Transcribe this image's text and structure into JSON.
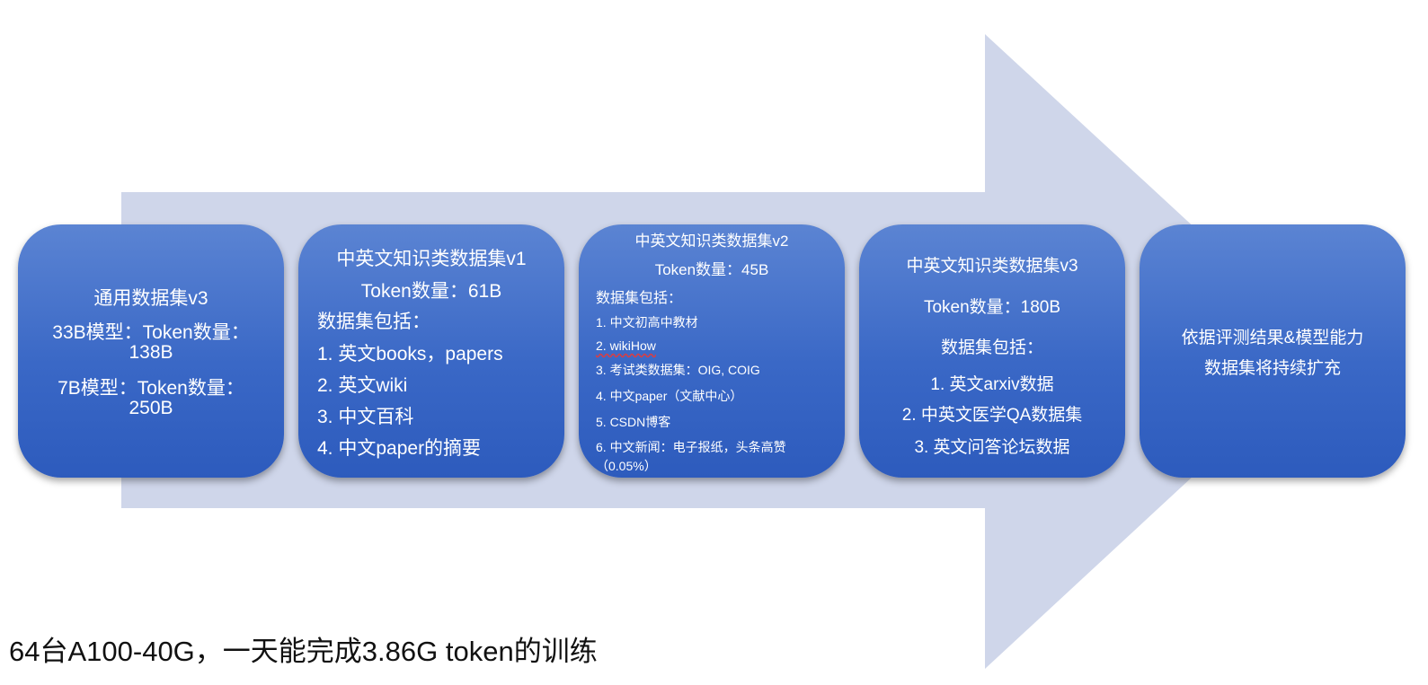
{
  "colors": {
    "arrow": "#cfd6ea",
    "card_top": "#5b84d3",
    "card_bottom": "#2d5bbd",
    "text": "#ffffff"
  },
  "card1": {
    "title": "通用数据集v3",
    "line1": "33B模型：Token数量：",
    "line2": "138B",
    "line3": "7B模型：Token数量：",
    "line4": "250B"
  },
  "card2": {
    "title": "中英文知识类数据集v1",
    "tokens": "Token数量：61B",
    "includes": "数据集包括：",
    "items": [
      "1. 英文books，papers",
      "2. 英文wiki",
      "3. 中文百科",
      "4. 中文paper的摘要"
    ]
  },
  "card3": {
    "title": "中英文知识类数据集v2",
    "tokens": "Token数量：45B",
    "includes": "数据集包括：",
    "items": [
      "1. 中文初高中教材",
      "2. wikiHow",
      "3. 考试类数据集：OIG, COIG",
      "4. 中文paper（文献中心）",
      "5. CSDN博客",
      "6. 中文新闻：电子报纸，头条高赞",
      "（0.05%）"
    ]
  },
  "card4": {
    "title": "中英文知识类数据集v3",
    "tokens": "Token数量：180B",
    "includes": "数据集包括：",
    "items": [
      "1. 英文arxiv数据",
      "2. 中英文医学QA数据集",
      "3. 英文问答论坛数据"
    ]
  },
  "card5": {
    "line1": "依据评测结果&模型能力",
    "line2": "数据集将持续扩充"
  },
  "caption": "64台A100-40G，一天能完成3.86G token的训练"
}
